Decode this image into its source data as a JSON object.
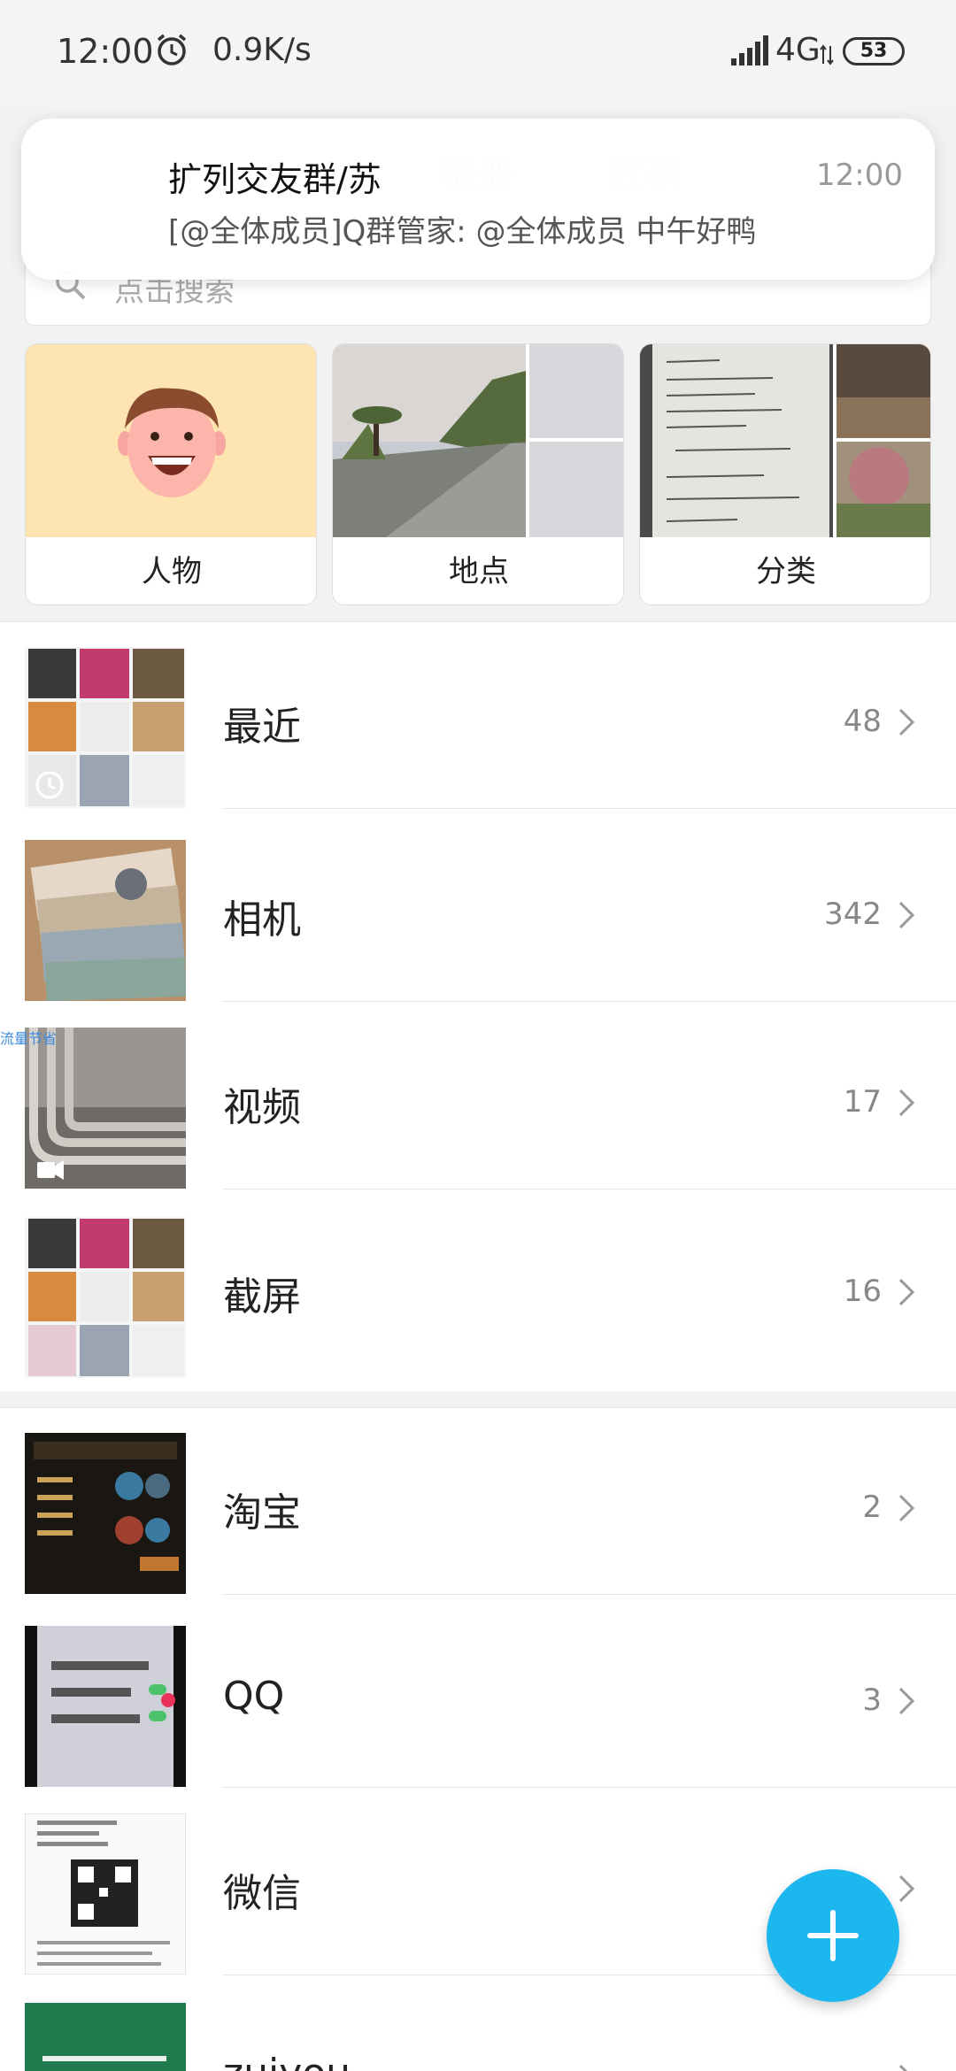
{
  "status_bar": {
    "time": "12:00",
    "speed": "0.9K/s",
    "network": "4G",
    "battery": "53",
    "icons": [
      "alarm-icon",
      "signal-icon",
      "network-arrows-icon",
      "battery-icon"
    ]
  },
  "tabs": [
    {
      "label": "相册"
    },
    {
      "label": "故事"
    }
  ],
  "search": {
    "placeholder": "点击搜索"
  },
  "notification": {
    "title": "扩列交友群/苏",
    "time": "12:00",
    "body": "[@全体成员]Q群管家: @全体成员 中午好鸭"
  },
  "categories": [
    {
      "label": "人物"
    },
    {
      "label": "地点"
    },
    {
      "label": "分类"
    }
  ],
  "albums_primary": [
    {
      "name": "最近",
      "count": "48"
    },
    {
      "name": "相机",
      "count": "342"
    },
    {
      "name": "视频",
      "count": "17"
    },
    {
      "name": "截屏",
      "count": "16"
    }
  ],
  "albums_other": [
    {
      "name": "淘宝",
      "count": "2"
    },
    {
      "name": "QQ",
      "count": "3"
    },
    {
      "name": "微信",
      "count": ""
    },
    {
      "name": "zuiyou",
      "count": ""
    }
  ],
  "side_tag": "流量节省",
  "fab": {
    "icon": "plus-icon"
  },
  "colors": {
    "accent": "#1cb7ef",
    "tab_active": "#3aa3d8"
  }
}
